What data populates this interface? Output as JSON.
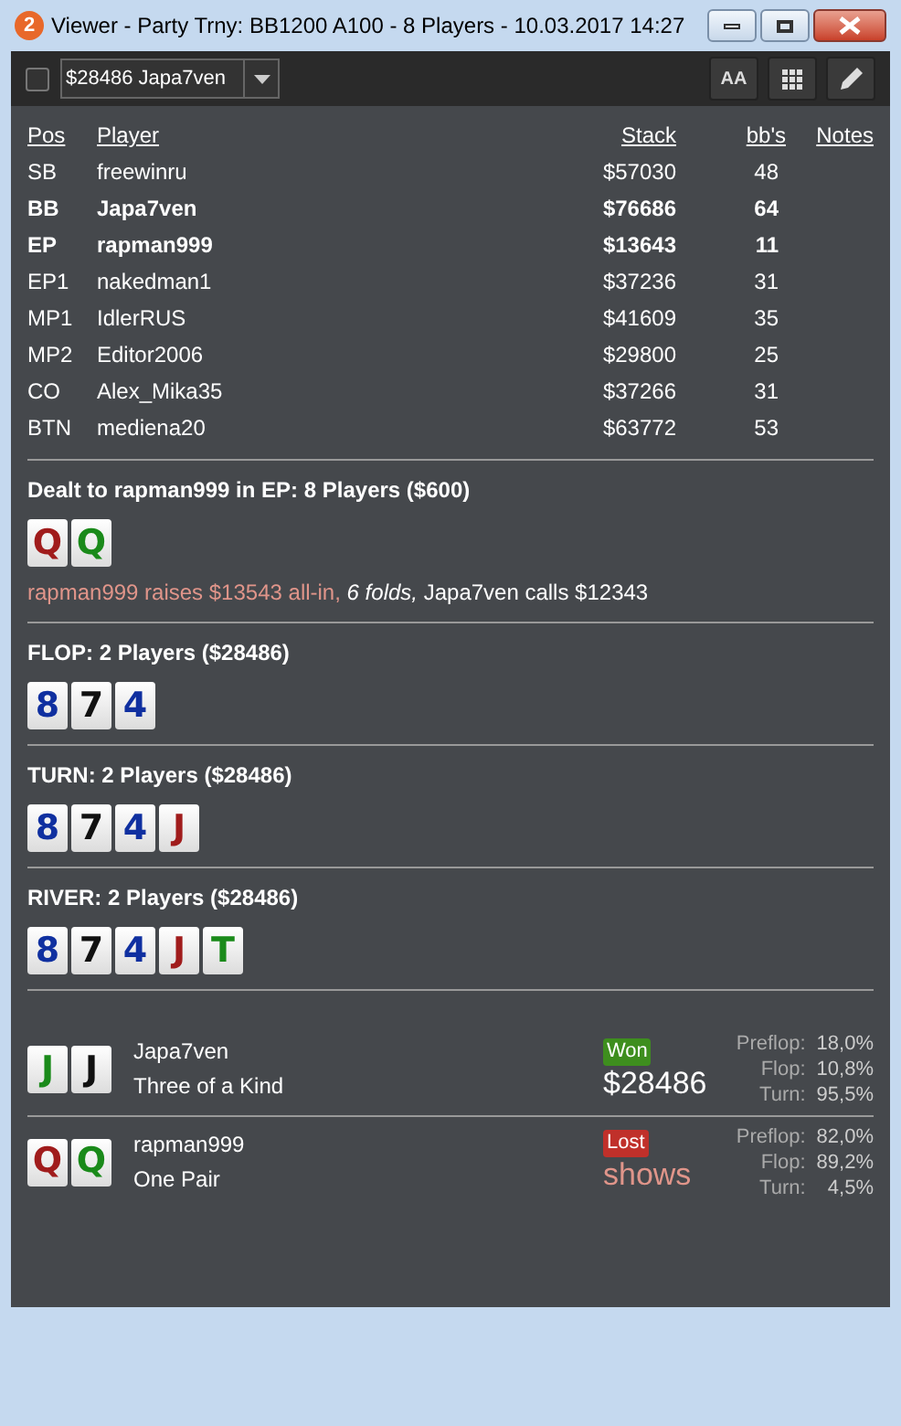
{
  "window": {
    "badge": "2",
    "title": "Viewer - Party Trny: BB1200 A100 - 8 Players - 10.03.2017 14:27"
  },
  "toolbar": {
    "checked": false,
    "hand_select": "$28486 Japa7ven",
    "font_button": "AA"
  },
  "players": {
    "columns": [
      "Pos",
      "Player",
      "Stack",
      "bb's",
      "Notes"
    ],
    "rows": [
      {
        "pos": "SB",
        "player": "freewinru",
        "stack": "$57030",
        "bbs": "48",
        "bold": false
      },
      {
        "pos": "BB",
        "player": "Japa7ven",
        "stack": "$76686",
        "bbs": "64",
        "bold": true
      },
      {
        "pos": "EP",
        "player": "rapman999",
        "stack": "$13643",
        "bbs": "11",
        "bold": true
      },
      {
        "pos": "EP1",
        "player": "nakedman1",
        "stack": "$37236",
        "bbs": "31",
        "bold": false
      },
      {
        "pos": "MP1",
        "player": "IdlerRUS",
        "stack": "$41609",
        "bbs": "35",
        "bold": false
      },
      {
        "pos": "MP2",
        "player": "Editor2006",
        "stack": "$29800",
        "bbs": "25",
        "bold": false
      },
      {
        "pos": "CO",
        "player": "Alex_Mika35",
        "stack": "$37266",
        "bbs": "31",
        "bold": false
      },
      {
        "pos": "BTN",
        "player": "mediena20",
        "stack": "$63772",
        "bbs": "53",
        "bold": false
      }
    ]
  },
  "streets": [
    {
      "title": "Dealt to rapman999 in EP: 8 Players ($600)",
      "cards": [
        {
          "rank": "Q",
          "color": "#a01c1c"
        },
        {
          "rank": "Q",
          "color": "#1a8a1a"
        }
      ],
      "action": [
        {
          "kind": "raise",
          "text": "rapman999 raises $13543 all-in,"
        },
        {
          "kind": "fold",
          "text": "6 folds,"
        },
        {
          "kind": "call",
          "text": "Japa7ven calls $12343"
        }
      ]
    },
    {
      "title": "FLOP: 2 Players ($28486)",
      "cards": [
        {
          "rank": "8",
          "color": "#1030a0"
        },
        {
          "rank": "7",
          "color": "#111111"
        },
        {
          "rank": "4",
          "color": "#1030a0"
        }
      ]
    },
    {
      "title": "TURN: 2 Players ($28486)",
      "cards": [
        {
          "rank": "8",
          "color": "#1030a0"
        },
        {
          "rank": "7",
          "color": "#111111"
        },
        {
          "rank": "4",
          "color": "#1030a0"
        },
        {
          "rank": "J",
          "color": "#a01c1c"
        }
      ]
    },
    {
      "title": "RIVER: 2 Players ($28486)",
      "cards": [
        {
          "rank": "8",
          "color": "#1030a0"
        },
        {
          "rank": "7",
          "color": "#111111"
        },
        {
          "rank": "4",
          "color": "#1030a0"
        },
        {
          "rank": "J",
          "color": "#a01c1c"
        },
        {
          "rank": "T",
          "color": "#1a8a1a"
        }
      ]
    }
  ],
  "results": [
    {
      "cards": [
        {
          "rank": "J",
          "color": "#1a8a1a"
        },
        {
          "rank": "J",
          "color": "#111111"
        }
      ],
      "player": "Japa7ven",
      "hand": "Three of a Kind",
      "kind": "won",
      "result_label": "Won",
      "amount": "$28486",
      "odds": [
        {
          "label": "Preflop:",
          "value": "18,0%"
        },
        {
          "label": "Flop:",
          "value": "10,8%"
        },
        {
          "label": "Turn:",
          "value": "95,5%"
        }
      ]
    },
    {
      "cards": [
        {
          "rank": "Q",
          "color": "#a01c1c"
        },
        {
          "rank": "Q",
          "color": "#1a8a1a"
        }
      ],
      "player": "rapman999",
      "hand": "One Pair",
      "kind": "lost",
      "result_label": "Lost",
      "amount": "shows",
      "odds": [
        {
          "label": "Preflop:",
          "value": "82,0%"
        },
        {
          "label": "Flop:",
          "value": "89,2%"
        },
        {
          "label": "Turn:",
          "value": "4,5%"
        }
      ]
    }
  ]
}
